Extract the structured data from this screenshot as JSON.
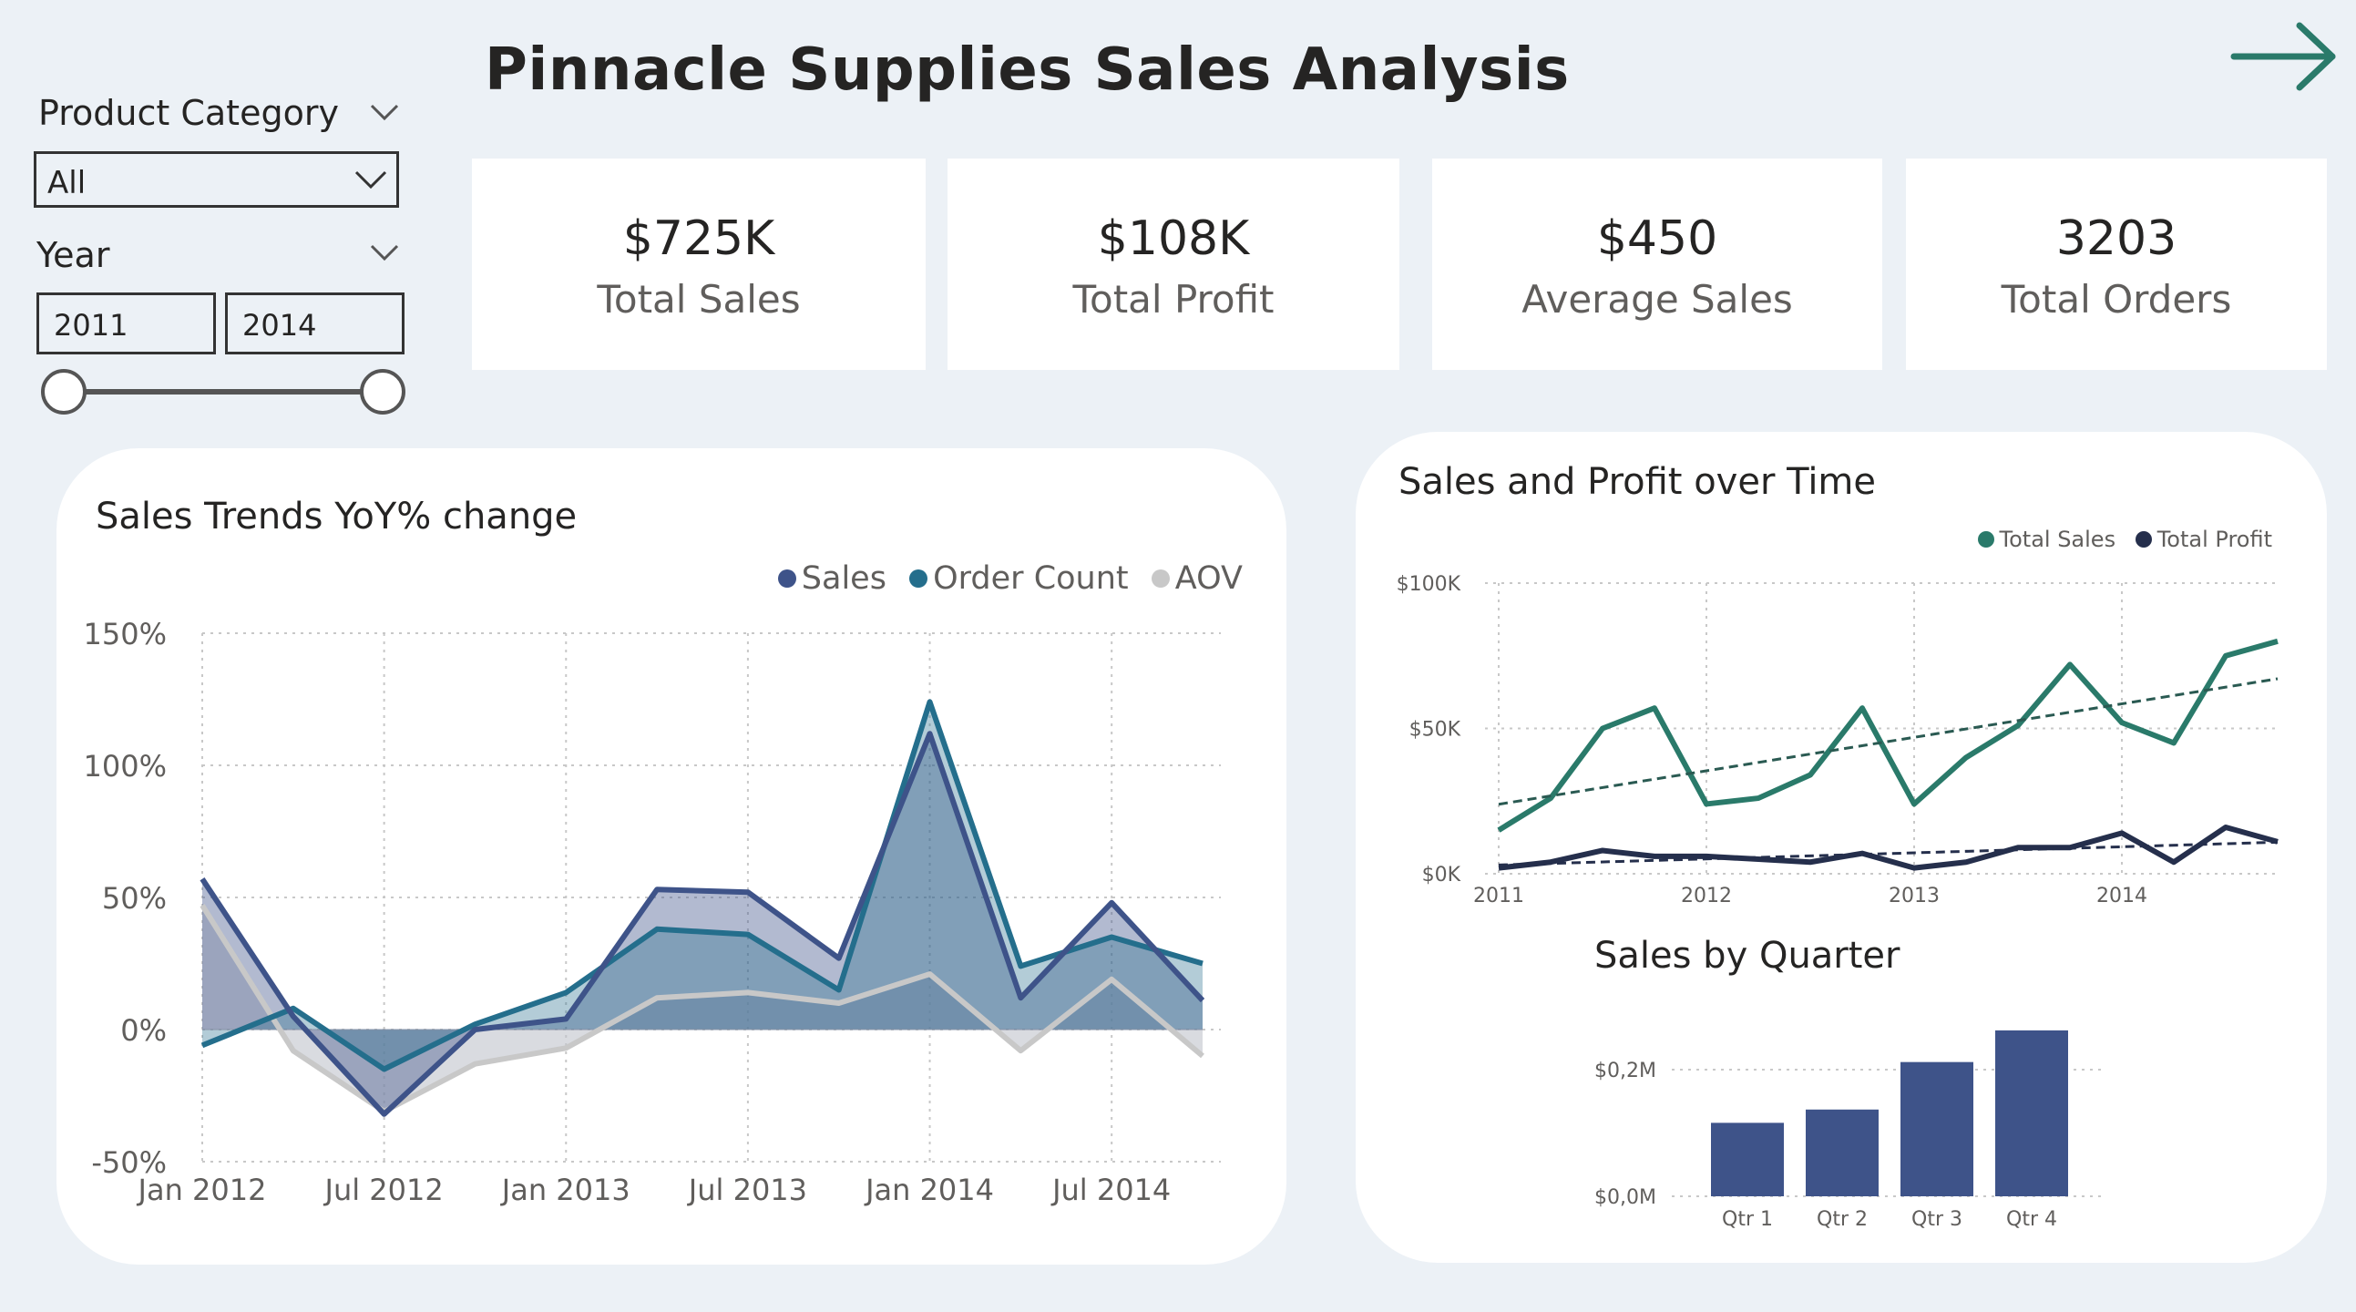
{
  "header": {
    "title": "Pinnacle Supplies Sales Analysis",
    "nav_icon": "arrow-right-icon",
    "accent_color": "#2A7A6A"
  },
  "filters": {
    "product_category": {
      "label": "Product Category",
      "selected": "All"
    },
    "year": {
      "label": "Year",
      "from": "2011",
      "to": "2014"
    }
  },
  "kpis": [
    {
      "value": "$725K",
      "label": "Total Sales"
    },
    {
      "value": "$108K",
      "label": "Total Profit"
    },
    {
      "value": "$450",
      "label": "Average Sales"
    },
    {
      "value": "3203",
      "label": "Total Orders"
    }
  ],
  "chart_data": [
    {
      "type": "area",
      "title": "Sales Trends YoY% change",
      "y_tick_labels": [
        "150%",
        "100%",
        "50%",
        "0%",
        "-50%"
      ],
      "x_tick_labels": [
        "Jan 2012",
        "Jul 2012",
        "Jan 2013",
        "Jul 2013",
        "Jan 2014",
        "Jul 2014"
      ],
      "ylim": [
        -50,
        150
      ],
      "grid": true,
      "legend_position": "top-right",
      "x": [
        "2012-01",
        "2012-04",
        "2012-07",
        "2012-10",
        "2013-01",
        "2013-04",
        "2013-07",
        "2013-10",
        "2014-01",
        "2014-04",
        "2014-07",
        "2014-10"
      ],
      "series": [
        {
          "name": "Sales",
          "color": "#3E5389",
          "values": [
            57,
            5,
            -32,
            0,
            4,
            53,
            52,
            27,
            112,
            12,
            48,
            11
          ]
        },
        {
          "name": "Order Count",
          "color": "#246E8C",
          "values": [
            -6,
            8,
            -15,
            2,
            14,
            38,
            36,
            15,
            124,
            24,
            35,
            25
          ]
        },
        {
          "name": "AOV",
          "color": "#C8C8C8",
          "values": [
            47,
            -8,
            -31,
            -13,
            -7,
            12,
            14,
            10,
            21,
            -8,
            19,
            -10
          ]
        }
      ]
    },
    {
      "type": "line",
      "title": "Sales and Profit over Time",
      "y_tick_labels": [
        "$100K",
        "$50K",
        "$0K"
      ],
      "x_tick_labels": [
        "2011",
        "2012",
        "2013",
        "2014"
      ],
      "ylim": [
        0,
        100000
      ],
      "grid": true,
      "legend_position": "top-right",
      "trend_lines": true,
      "x": [
        "2011-Q1",
        "2011-Q2",
        "2011-Q3",
        "2011-Q4",
        "2012-Q1",
        "2012-Q2",
        "2012-Q3",
        "2012-Q4",
        "2013-Q1",
        "2013-Q2",
        "2013-Q3",
        "2013-Q4",
        "2014-Q1",
        "2014-Q2",
        "2014-Q3",
        "2014-Q4"
      ],
      "series": [
        {
          "name": "Total Sales",
          "color": "#2A7A6A",
          "values": [
            15000,
            26000,
            50000,
            57000,
            24000,
            26000,
            34000,
            57000,
            24000,
            40000,
            51000,
            72000,
            52000,
            45000,
            75000,
            80000
          ]
        },
        {
          "name": "Total Profit",
          "color": "#252F4C",
          "values": [
            2000,
            4000,
            8000,
            6000,
            6000,
            5000,
            4000,
            7000,
            2000,
            4000,
            9000,
            9000,
            14000,
            4000,
            16000,
            11000
          ]
        }
      ]
    },
    {
      "type": "bar",
      "title": "Sales by Quarter",
      "categories": [
        "Qtr 1",
        "Qtr 2",
        "Qtr 3",
        "Qtr 4"
      ],
      "values": [
        0.116,
        0.137,
        0.212,
        0.262
      ],
      "y_tick_labels": [
        "$0,2M",
        "$0,0M"
      ],
      "ylim": [
        0,
        0.3
      ],
      "color": "#3E5389"
    }
  ]
}
